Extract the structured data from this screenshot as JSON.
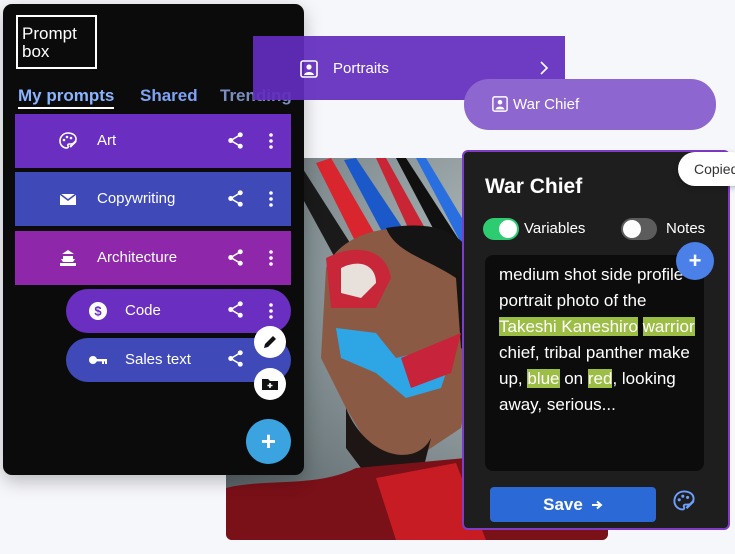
{
  "logo": {
    "text": "Prompt\nbox"
  },
  "tabs": [
    {
      "label": "My prompts"
    },
    {
      "label": "Shared"
    },
    {
      "label": "Trending"
    }
  ],
  "prompt_list": [
    {
      "label": "Art",
      "icon": "palette-icon"
    },
    {
      "label": "Copywriting",
      "icon": "envelope-icon"
    },
    {
      "label": "Architecture",
      "icon": "building-icon"
    }
  ],
  "sub_list": [
    {
      "label": "Code",
      "icon": "dollar-icon"
    },
    {
      "label": "Sales text",
      "icon": "key-icon"
    }
  ],
  "drag_items": {
    "portraits": "Portraits",
    "war_chief": "War Chief"
  },
  "editor": {
    "title": "War Chief",
    "toggles": {
      "variables": "Variables",
      "notes": "Notes",
      "variables_on": true,
      "notes_on": false
    },
    "prompt_parts": {
      "p1": "medium shot side profile portrait photo of the ",
      "v1": "Takeshi Kaneshiro",
      "v2": "warrior",
      "p2": " chief, tribal panther make up, ",
      "v3": "blue",
      "p3": " on ",
      "v4": "red",
      "p4": ", looking away, serious..."
    },
    "save_label": "Save"
  },
  "toast": {
    "text": "Copied"
  },
  "colors": {
    "accent_purple": "#6a2fc0",
    "accent_blue": "#3f4ab8",
    "highlight": "#8db33f",
    "save": "#2a69d6"
  }
}
